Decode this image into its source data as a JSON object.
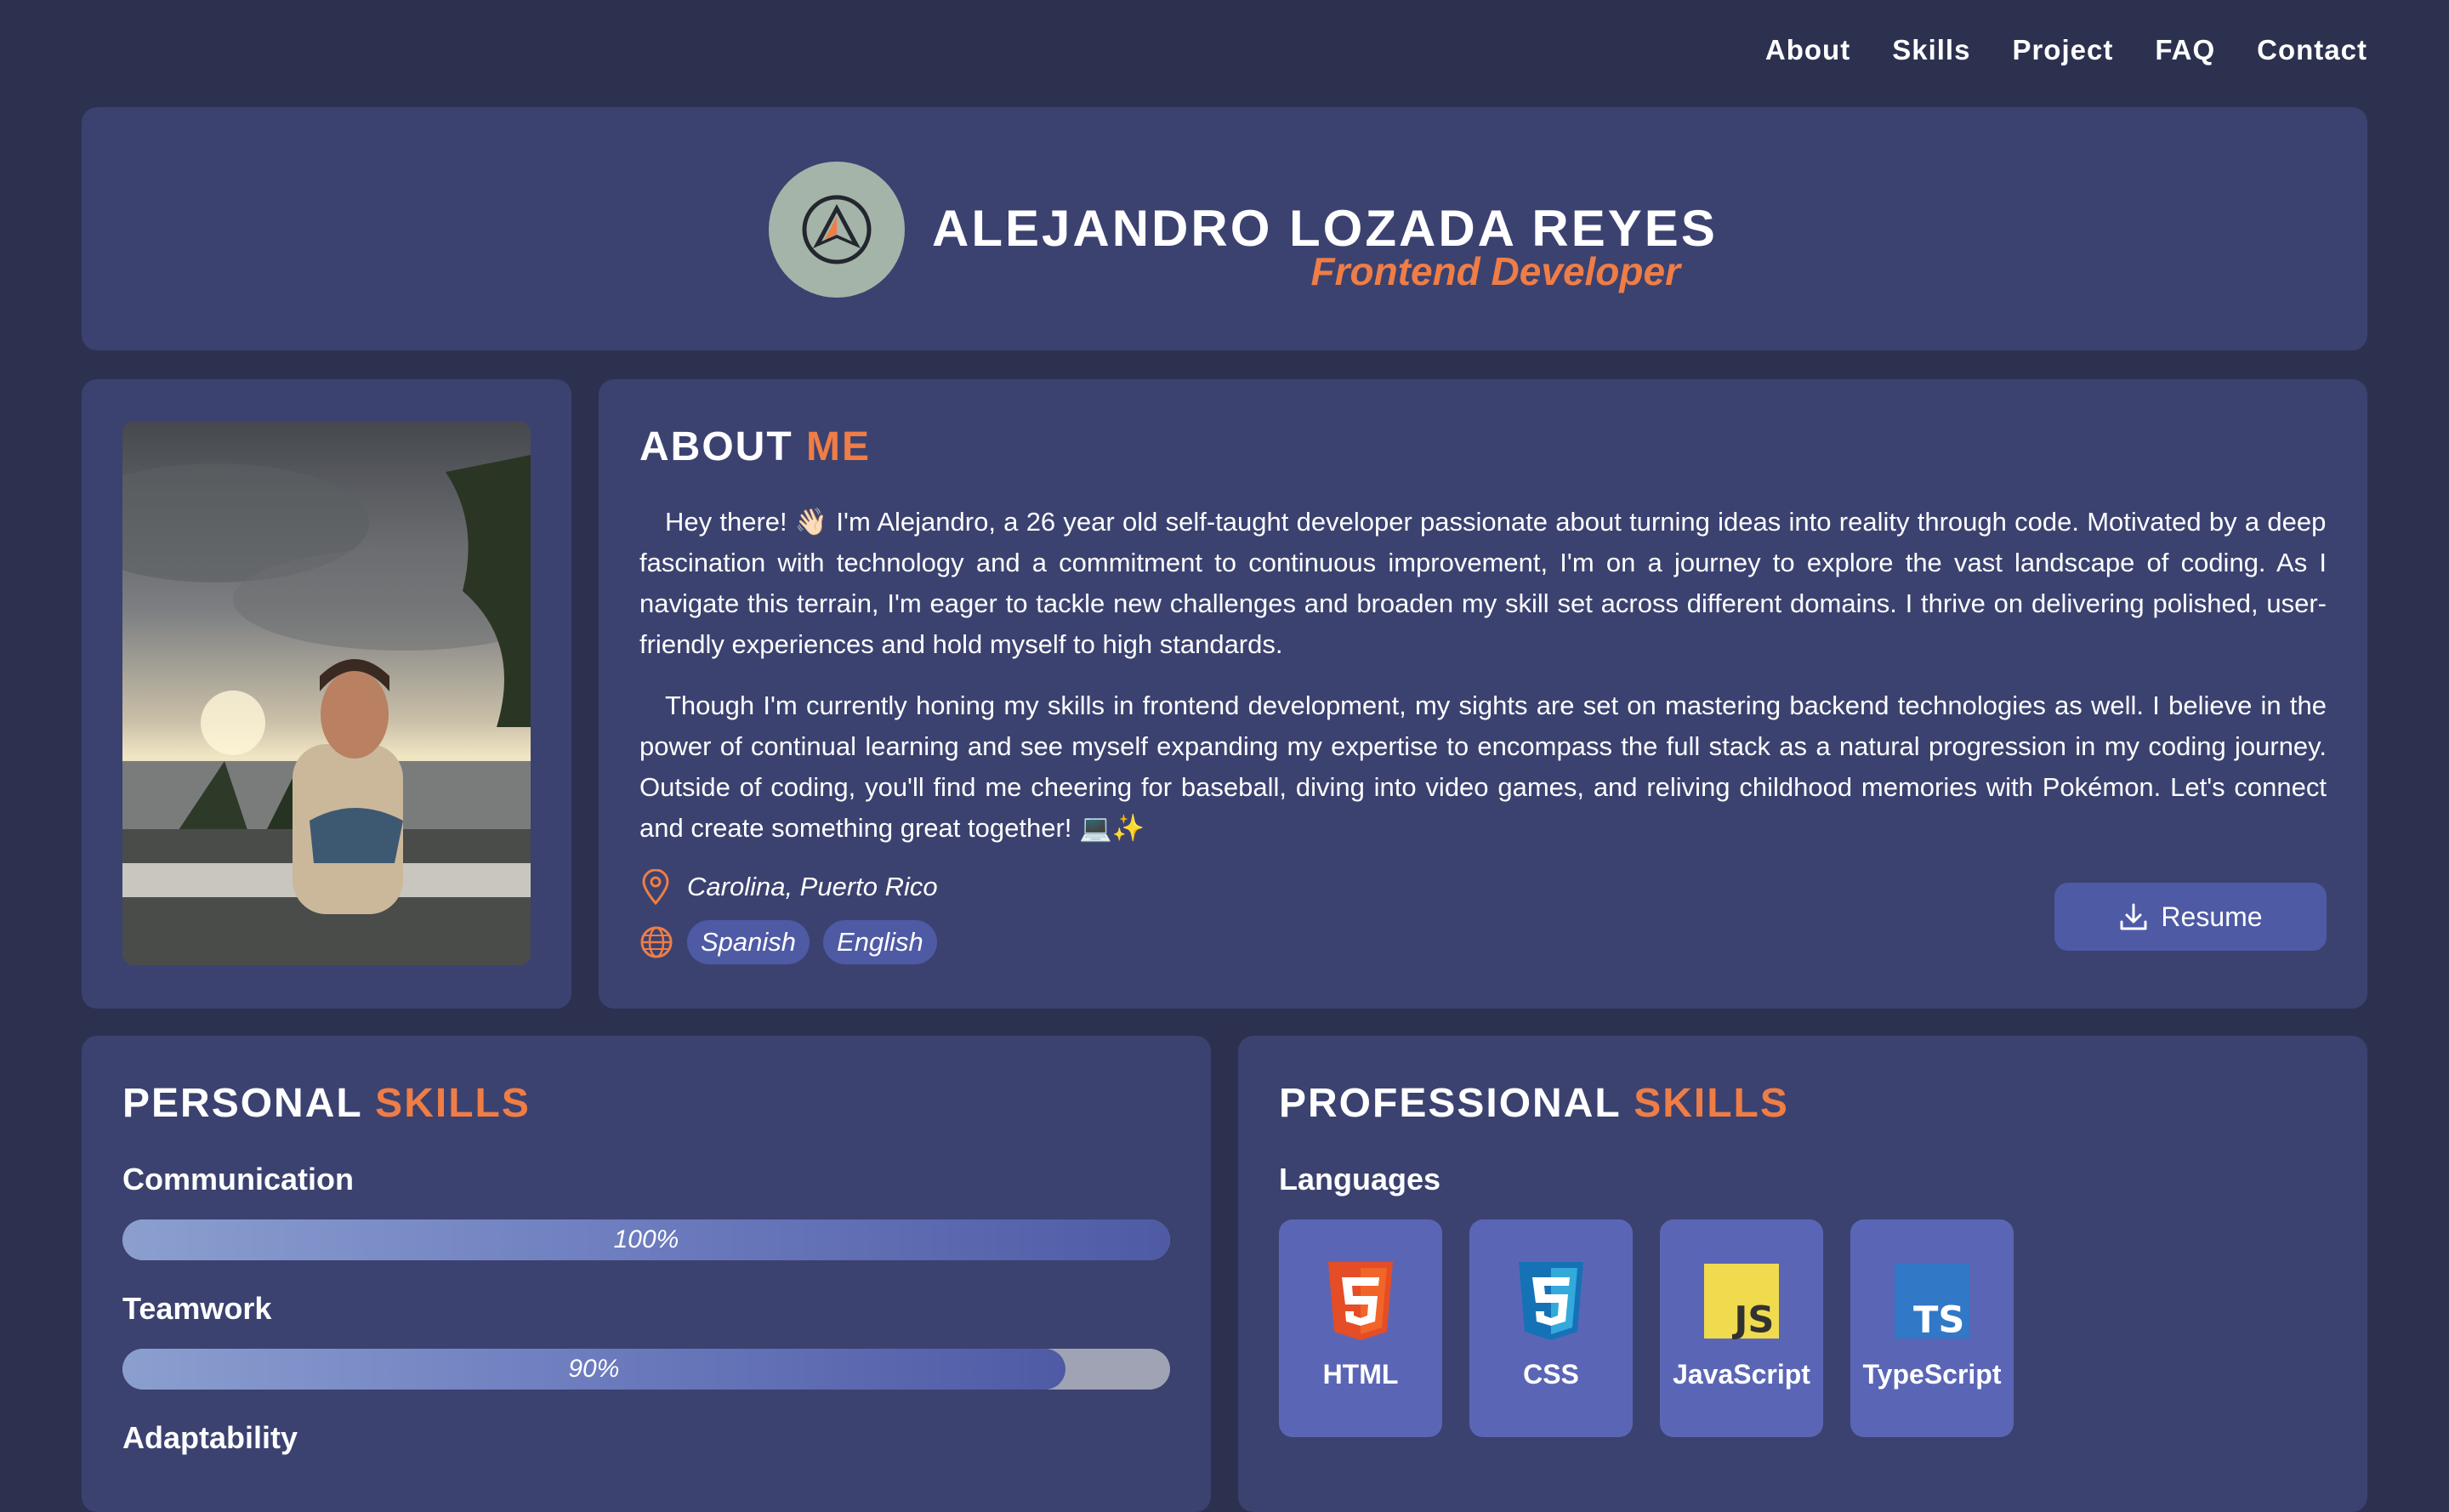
{
  "nav": [
    "About",
    "Skills",
    "Project",
    "FAQ",
    "Contact"
  ],
  "header": {
    "name": "ALEJANDRO LOZADA REYES",
    "role": "Frontend Developer"
  },
  "about": {
    "title_main": "ABOUT",
    "title_accent": "ME",
    "paragraphs": [
      "Hey there! 👋🏻 I'm Alejandro, a 26 year old self-taught developer passionate about turning ideas into reality through code. Motivated by a deep fascination with technology and a commitment to continuous improvement, I'm on a journey to explore the vast landscape of coding. As I navigate this terrain, I'm eager to tackle new challenges and broaden my skill set across different domains. I thrive on delivering polished, user-friendly experiences and hold myself to high standards.",
      "Though I'm currently honing my skills in frontend development, my sights are set on mastering backend technologies as well. I believe in the power of continual learning and see myself expanding my expertise to encompass the full stack as a natural progression in my coding journey. Outside of coding, you'll find me cheering for baseball, diving into video games, and reliving childhood memories with Pokémon. Let's connect and create something great together! 💻✨"
    ],
    "location": "Carolina, Puerto Rico",
    "languages": [
      "Spanish",
      "English"
    ],
    "resume_label": "Resume"
  },
  "personal_skills": {
    "title_main": "PERSONAL",
    "title_accent": "SKILLS",
    "items": [
      {
        "label": "Communication",
        "percent_text": "100%",
        "value": 100
      },
      {
        "label": "Teamwork",
        "percent_text": "90%",
        "value": 90
      },
      {
        "label": "Adaptability",
        "percent_text": "",
        "value": null
      }
    ]
  },
  "professional_skills": {
    "title_main": "PROFESSIONAL",
    "title_accent": "SKILLS",
    "subheading": "Languages",
    "languages": [
      {
        "label": "HTML",
        "icon": "html5-icon"
      },
      {
        "label": "CSS",
        "icon": "css3-icon"
      },
      {
        "label": "JavaScript",
        "icon": "javascript-icon"
      },
      {
        "label": "TypeScript",
        "icon": "typescript-icon"
      }
    ]
  },
  "colors": {
    "background": "#2d3150",
    "card": "#3b4270",
    "accent": "#ef7d45",
    "button": "#4f5aa5"
  }
}
